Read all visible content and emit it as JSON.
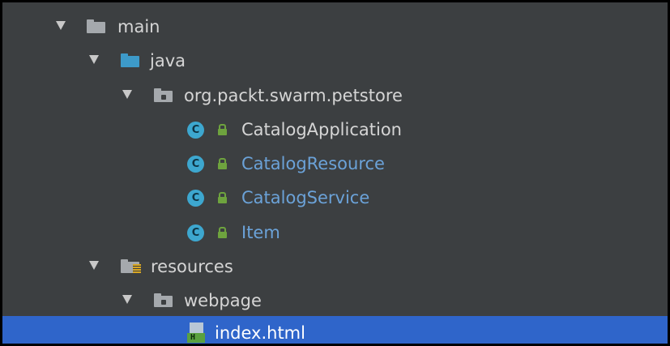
{
  "tree": {
    "main": "main",
    "java": "java",
    "package": "org.packt.swarm.petstore",
    "classes": [
      {
        "name": "CatalogApplication",
        "icon": "C"
      },
      {
        "name": "CatalogResource",
        "icon": "C"
      },
      {
        "name": "CatalogService",
        "icon": "C"
      },
      {
        "name": "Item",
        "icon": "C"
      }
    ],
    "resources": "resources",
    "webpage": "webpage",
    "file": "index.html",
    "file_badge": "H"
  },
  "colors": {
    "background": "#3c3f41",
    "selection": "#2f65ca",
    "text": "#d5d5d5",
    "modified_text": "#6ba2d8",
    "class_icon": "#3da7cf",
    "lock_icon": "#6ea33e"
  }
}
